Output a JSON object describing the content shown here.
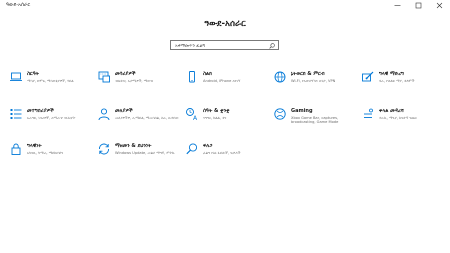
{
  "window": {
    "title": "ዓውደ-አሰራር",
    "controls": [
      "minimize-icon",
      "maximize-icon",
      "close-icon"
    ]
  },
  "page": {
    "title": "ዓውደ-አሰራር"
  },
  "search": {
    "placeholder": "አቀማመጥን ፈልግ"
  },
  "accent_color": "#0078d7",
  "tiles": [
    {
      "id": "system",
      "label": "ስርዓት",
      "desc": "ማሳያ, ድምፅ, ማሳወቂያዎች, ሃይል",
      "icon": "laptop-icon"
    },
    {
      "id": "devices",
      "label": "መሳሪያዎች",
      "desc": "ብሉቱዝ, አታሚዎች, ማውዝ",
      "icon": "keyboard-icon"
    },
    {
      "id": "phone",
      "label": "ስልክ",
      "desc": "Android, iPhone አገናኝ",
      "icon": "phone-icon"
    },
    {
      "id": "network",
      "label": "ኔትወርክ & ምርብ",
      "desc": "Wi-Fi, የአውሮፕላን ሁነታ, VPN",
      "icon": "globe-icon"
    },
    {
      "id": "personalization",
      "label": "ግላዊ ማድረግ",
      "desc": "ዳራ, የቆልፍ ማያ, ቀለሞች",
      "icon": "paintbrush-icon"
    },
    {
      "id": "apps",
      "label": "መተግበሪያዎች",
      "desc": "አራግፍ, ነባሪዎች, አማራጭ ባህሪያት",
      "icon": "apps-list-icon"
    },
    {
      "id": "accounts",
      "label": "መለያዎች",
      "desc": "መለያዎችዎ, ኢሜይል, ማመሳሰል, ስራ, ቤተሰብ",
      "icon": "person-icon"
    },
    {
      "id": "time",
      "label": "ሰዓት & ቋንቋ",
      "desc": "ንግግር, ክልል, ቀን",
      "icon": "time-language-icon"
    },
    {
      "id": "gaming",
      "label": "Gaming",
      "desc": "Xbox Game Bar, captures, broadcasting, Game Mode",
      "icon": "xbox-icon"
    },
    {
      "id": "ease",
      "label": "ቀላል መዳረሻ",
      "desc": "ተራኪ, ማጉያ, ከፍተኛ ንፅፅር",
      "icon": "ease-of-access-icon"
    },
    {
      "id": "privacy",
      "label": "ግላዊነት",
      "desc": "አካባቢ, ካሜራ, ማይክሮፎን",
      "icon": "lock-icon"
    },
    {
      "id": "update",
      "label": "ማዘመን & ደህንነት",
      "desc": "Windows Update, መልሶ ማግኛ, ምትኬ",
      "icon": "sync-icon"
    },
    {
      "id": "search",
      "label": "ፍለጋ",
      "desc": "ፈልግ የእኔ ፋይሎች, ፍቃዶች",
      "icon": "search-icon"
    }
  ]
}
